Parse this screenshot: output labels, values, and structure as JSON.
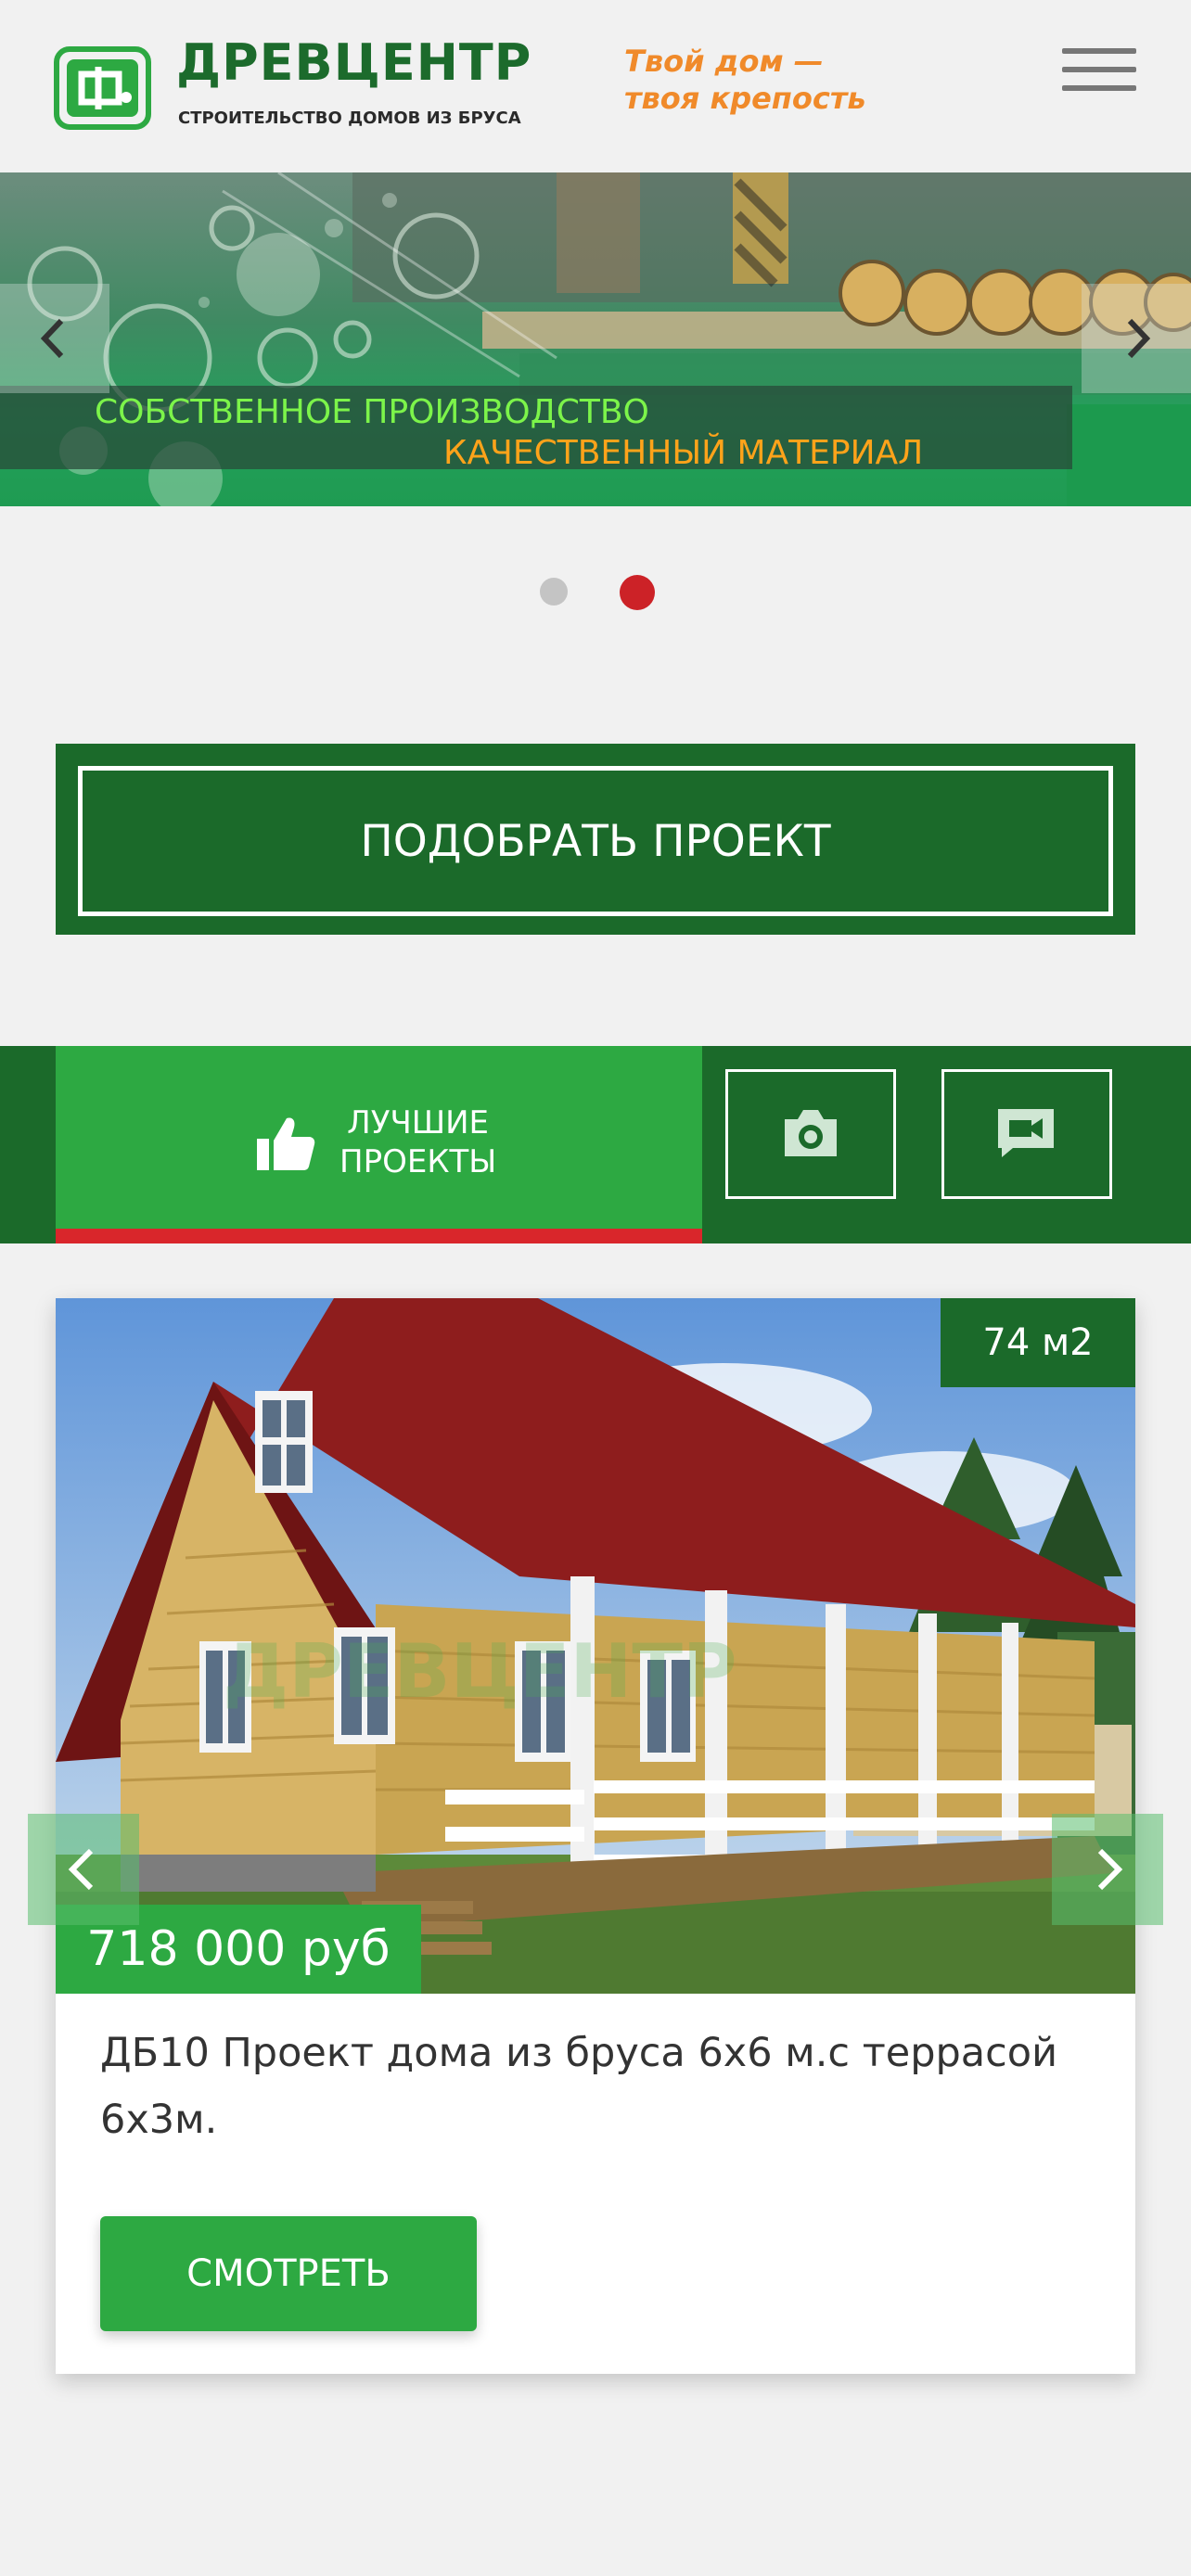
{
  "header": {
    "brand_name": "ДРЕВЦЕНТР",
    "brand_subtitle": "СТРОИТЕЛЬСТВО ДОМОВ ИЗ БРУСА",
    "slogan_line1": "Твой дом —",
    "slogan_line2": "твоя крепость",
    "menu_icon": "hamburger-icon"
  },
  "banner": {
    "caption_line1": "СОБСТВЕННОЕ ПРОИЗВОДСТВО",
    "caption_line2": "КАЧЕСТВЕННЫЙ МАТЕРИАЛ",
    "prev_icon": "chevron-left-icon",
    "next_icon": "chevron-right-icon",
    "slides_total": 2,
    "active_slide": 2
  },
  "cta": {
    "label": "ПОДОБРАТЬ ПРОЕКТ"
  },
  "tabs": {
    "best_line1": "ЛУЧШИЕ",
    "best_line2": "ПРОЕКТЫ",
    "best_icon": "thumbs-up-icon",
    "photo_icon": "camera-icon",
    "video_icon": "video-camera-icon"
  },
  "project_card": {
    "area": "74 м2",
    "price": "718 000 руб",
    "title": "ДБ10 Проект дома из бруса 6х6 м.с террасой 6х3м.",
    "view_label": "СМОТРЕТЬ"
  },
  "colors": {
    "dark_green": "#1b6a2a",
    "green": "#2da942",
    "red_accent": "#d9262b",
    "orange": "#f08a2a"
  }
}
